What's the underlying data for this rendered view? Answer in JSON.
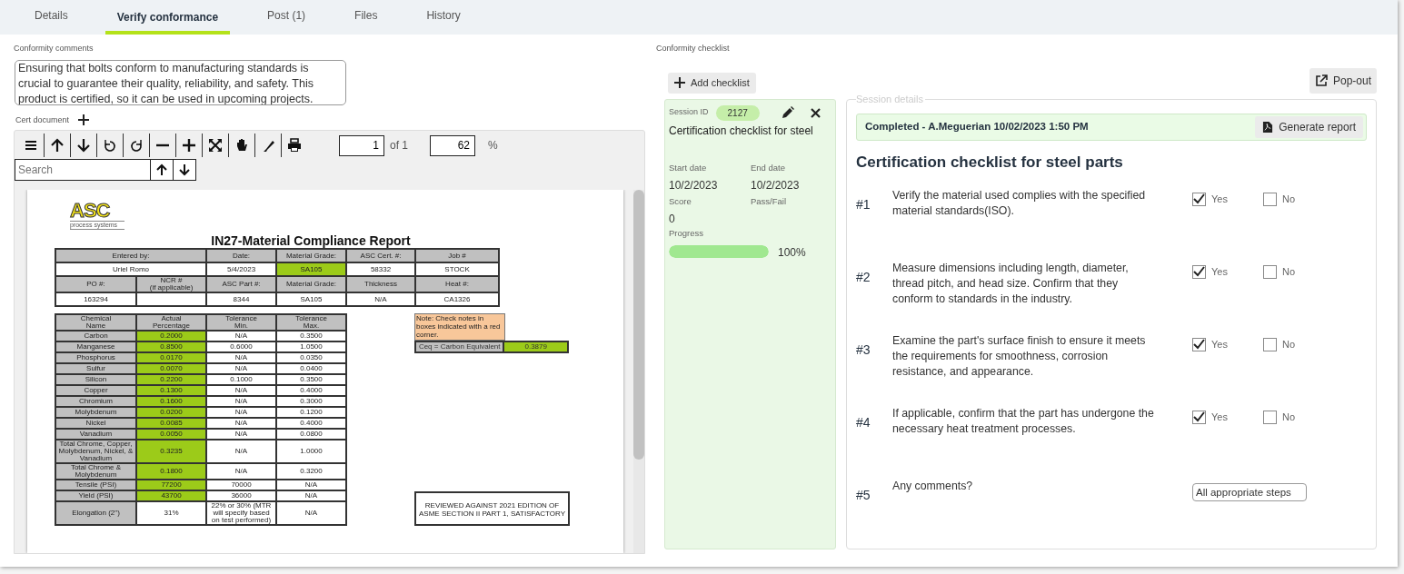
{
  "tabs": [
    {
      "label": "Details",
      "selected": false
    },
    {
      "label": "Verify conformance",
      "selected": true
    },
    {
      "label": "Post (1)",
      "selected": false
    },
    {
      "label": "Files",
      "selected": false
    },
    {
      "label": "History",
      "selected": false
    }
  ],
  "conformity_comments": {
    "label": "Conformity comments",
    "value": "Ensuring that bolts conform to manufacturing standards is crucial to guarantee their quality, reliability, and safety. This product is certified, so it can be used in upcoming projects."
  },
  "cert_document": {
    "label": "Cert document",
    "viewer": {
      "page": "1",
      "page_count": "of 1",
      "zoom": "62",
      "zoom_unit": "%",
      "search": {
        "placeholder": "Search"
      }
    },
    "report": {
      "logo": "ASC",
      "logo_subtitle": "process systems",
      "title": "IN27-Material Compliance Report",
      "header_rows": [
        [
          {
            "text": "Entered by:",
            "kind": "head",
            "wide": true
          },
          {
            "text": "Date:",
            "kind": "head",
            "wide": false
          },
          {
            "text": "Material Grade:",
            "kind": "head",
            "wide": false
          },
          {
            "text": "ASC Cert. #:",
            "kind": "head",
            "wide": false
          },
          {
            "text": "Job #",
            "kind": "head",
            "wide": false
          }
        ],
        [
          {
            "text": "Uriel Romo",
            "kind": "plain",
            "wide": true
          },
          {
            "text": "5/4/2023",
            "kind": "plain",
            "wide": false
          },
          {
            "text": "SA105",
            "kind": "pass",
            "wide": false
          },
          {
            "text": "58332",
            "kind": "plain",
            "wide": false
          },
          {
            "text": "STOCK",
            "kind": "plain",
            "wide": false
          }
        ],
        [
          {
            "text": "PO #:",
            "kind": "head",
            "wide": false
          },
          {
            "text": "NCR #\n(if applicable)",
            "kind": "head",
            "wide": false
          },
          {
            "text": "ASC Part #:",
            "kind": "head",
            "wide": false
          },
          {
            "text": "Material Grade:",
            "kind": "head",
            "wide": false
          },
          {
            "text": "Thickness",
            "kind": "head",
            "wide": false
          },
          {
            "text": "Heat #:",
            "kind": "head",
            "wide": false
          }
        ],
        [
          {
            "text": "163294",
            "kind": "plain",
            "wide": false
          },
          {
            "kind": "plain",
            "wide": false
          },
          {
            "text": "8344",
            "kind": "plain",
            "wide": false
          },
          {
            "text": "SA105",
            "kind": "plain",
            "wide": false
          },
          {
            "text": "N/A",
            "kind": "plain",
            "wide": false
          },
          {
            "text": "CA1326",
            "kind": "plain",
            "wide": false
          }
        ]
      ],
      "chem_columns": [
        "Chemical\nName",
        "Actual\nPercentage",
        "Tolerance\nMin.",
        "Tolerance\nMax."
      ],
      "chem_rows": [
        {
          "name": "Carbon",
          "actual": "0.2000",
          "min": "N/A",
          "max": "0.3500",
          "pass": true
        },
        {
          "name": "Manganese",
          "actual": "0.8500",
          "min": "0.6000",
          "max": "1.0500",
          "pass": true
        },
        {
          "name": "Phosphorus",
          "actual": "0.0170",
          "min": "N/A",
          "max": "0.0350",
          "pass": true
        },
        {
          "name": "Sulfur",
          "actual": "0.0070",
          "min": "N/A",
          "max": "0.0400",
          "pass": true
        },
        {
          "name": "Silicon",
          "actual": "0.2200",
          "min": "0.1000",
          "max": "0.3500",
          "pass": true
        },
        {
          "name": "Copper",
          "actual": "0.1300",
          "min": "N/A",
          "max": "0.4000",
          "pass": true
        },
        {
          "name": "Chromium",
          "actual": "0.1600",
          "min": "N/A",
          "max": "0.3000",
          "pass": true
        },
        {
          "name": "Molybdenum",
          "actual": "0.0200",
          "min": "N/A",
          "max": "0.1200",
          "pass": true
        },
        {
          "name": "Nickel",
          "actual": "0.0085",
          "min": "N/A",
          "max": "0.4000",
          "pass": true
        },
        {
          "name": "Vanadium",
          "actual": "0.0050",
          "min": "N/A",
          "max": "0.0800",
          "pass": true
        },
        {
          "name": "Total Chrome, Copper, Molybdenum, Nickel, & Vanadium",
          "actual": "0.3235",
          "min": "N/A",
          "max": "1.0000",
          "pass": true
        },
        {
          "name": "Total Chrome & Molybdenum",
          "actual": "0.1800",
          "min": "N/A",
          "max": "0.3200",
          "pass": true
        },
        {
          "name": "Tensile (PSI)",
          "actual": "77200",
          "min": "70000",
          "max": "N/A",
          "pass": true
        },
        {
          "name": "Yield (PSI)",
          "actual": "43700",
          "min": "36000",
          "max": "N/A",
          "pass": true
        },
        {
          "name": "Elongation (2\")",
          "actual": "31%",
          "min": "22% or 30% (MTR will specify based on test performed)",
          "max": "N/A",
          "pass": false
        }
      ],
      "note": "Note: Check notes in boxes indicated with a red corner.",
      "ceq": {
        "label": "Ceq = Carbon Equivalent",
        "value": "0.3879",
        "pass": true
      },
      "review": "REVIEWED AGAINST 2021 EDITION OF ASME SECTION II PART 1, SATISFACTORY"
    }
  },
  "conformity_checklist": {
    "label": "Conformity checklist",
    "add_button": "Add checklist",
    "popout_button": "Pop-out",
    "session": {
      "id_label": "Session ID",
      "id": "2127",
      "title": "Certification checklist for steel",
      "fields": [
        {
          "label": "Start date",
          "value": "10/2/2023"
        },
        {
          "label": "End date",
          "value": "10/2/2023"
        },
        {
          "label": "Score",
          "value": "0"
        },
        {
          "label": "Pass/Fail"
        }
      ],
      "progress": {
        "label": "Progress",
        "level": 1,
        "reading": "100%"
      }
    },
    "details": {
      "legend": "Session details",
      "status": "Completed - A.Meguerian 10/02/2023 1:50 PM",
      "report_button": "Generate report",
      "title": "Certification checklist for steel parts",
      "items": [
        {
          "number": "#1",
          "kind": "yes_no",
          "text": "Verify the material used complies with the specified material standards(ISO).",
          "options": [
            {
              "label": "Yes",
              "checked": true
            },
            {
              "label": "No",
              "checked": false
            }
          ]
        },
        {
          "number": "#2",
          "kind": "yes_no",
          "text": "Measure dimensions including length, diameter, thread pitch, and head size. Confirm that they conform to standards in the industry.",
          "options": [
            {
              "label": "Yes",
              "checked": true
            },
            {
              "label": "No",
              "checked": false
            }
          ]
        },
        {
          "number": "#3",
          "kind": "yes_no",
          "text": "Examine the part's surface finish to ensure it meets the requirements for smoothness, corrosion resistance, and appearance.",
          "options": [
            {
              "label": "Yes",
              "checked": true
            },
            {
              "label": "No",
              "checked": false
            }
          ]
        },
        {
          "number": "#4",
          "kind": "yes_no",
          "text": "If applicable, confirm that the part has undergone the necessary heat treatment processes.",
          "options": [
            {
              "label": "Yes",
              "checked": true
            },
            {
              "label": "No",
              "checked": false
            }
          ]
        },
        {
          "number": "#5",
          "kind": "comment",
          "text": "Any comments?",
          "value": "All appropriate steps"
        }
      ]
    }
  }
}
